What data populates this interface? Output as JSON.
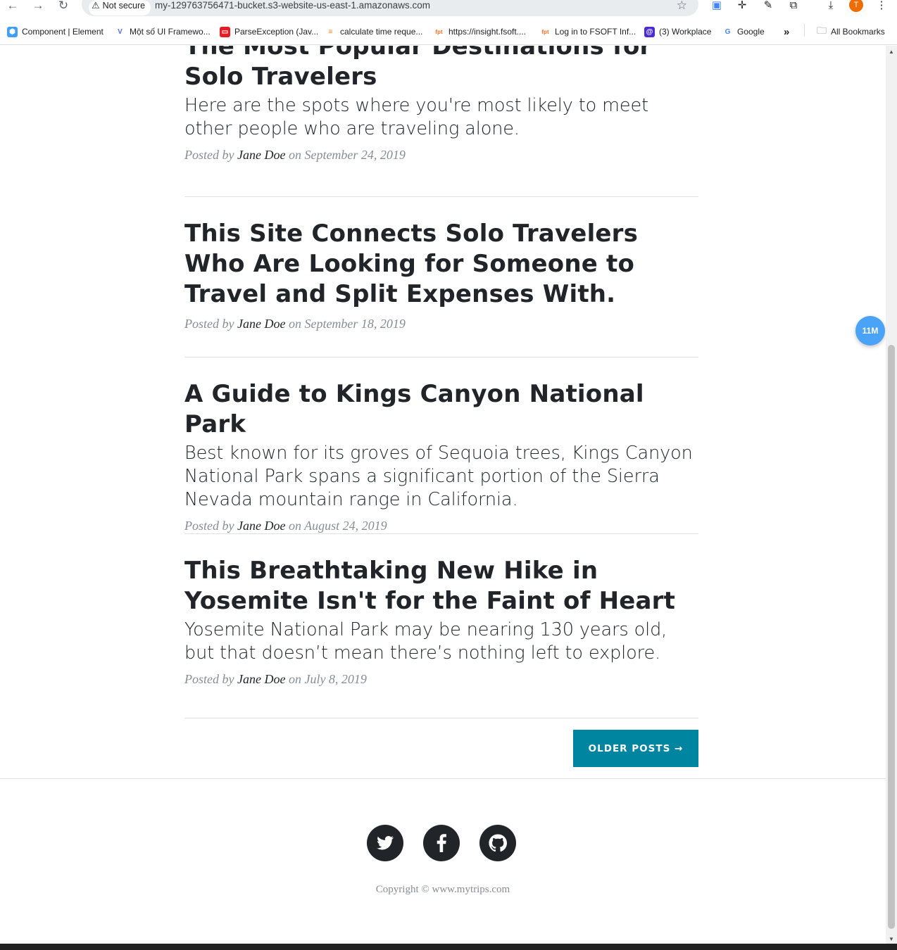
{
  "browser": {
    "security_label": "Not secure",
    "url": "my-129763756471-bucket.s3-website-us-east-1.amazonaws.com",
    "profile_initial": "T"
  },
  "bookmarks": {
    "items": [
      {
        "label": "Component | Element",
        "color": "#409eff"
      },
      {
        "label": "Một số UI Framewo...",
        "color": "#5b6ee1"
      },
      {
        "label": "ParseException (Jav...",
        "color": "#e51c23"
      },
      {
        "label": "calculate time reque...",
        "color": "#f48024"
      },
      {
        "label": "https://insight.fsoft....",
        "color": "#f37021"
      },
      {
        "label": "Log in to FSOFT Inf...",
        "color": "#f37021"
      },
      {
        "label": "(3) Workplace",
        "color": "#4b2bd6"
      },
      {
        "label": "Google",
        "color": "#4285f4"
      }
    ],
    "overflow": "»",
    "all_bookmarks": "All Bookmarks"
  },
  "posts": [
    {
      "title": "The Most Popular Destinations for Solo Travelers",
      "subtitle": "Here are the spots where you're most likely to meet other people who are traveling alone.",
      "posted_by": "Posted by",
      "author": "Jane Doe",
      "on": "on",
      "date": "September 24, 2019"
    },
    {
      "title": "This Site Connects Solo Travelers Who Are Looking for Someone to Travel and Split Expenses With.",
      "subtitle": "",
      "posted_by": "Posted by",
      "author": "Jane Doe",
      "on": "on",
      "date": "September 18, 2019"
    },
    {
      "title": "A Guide to Kings Canyon National Park",
      "subtitle": "Best known for its groves of Sequoia trees, Kings Canyon National Park spans a significant portion of the Sierra Nevada mountain range in California.",
      "posted_by": "Posted by",
      "author": "Jane Doe",
      "on": "on",
      "date": "August 24, 2019"
    },
    {
      "title": "This Breathtaking New Hike in Yosemite Isn't for the Faint of Heart",
      "subtitle": "Yosemite National Park may be nearing 130 years old, but that doesn’t mean there’s nothing left to explore.",
      "posted_by": "Posted by",
      "author": "Jane Doe",
      "on": "on",
      "date": "July 8, 2019"
    }
  ],
  "pager": {
    "older_label": "OLDER POSTS →"
  },
  "footer": {
    "social": [
      "twitter-icon",
      "facebook-icon",
      "github-icon"
    ],
    "copyright": "Copyright © www.mytrips.com"
  },
  "floating_badge": "11M",
  "colors": {
    "accent": "#0085a1",
    "heading": "#212529",
    "muted": "#868e96"
  }
}
